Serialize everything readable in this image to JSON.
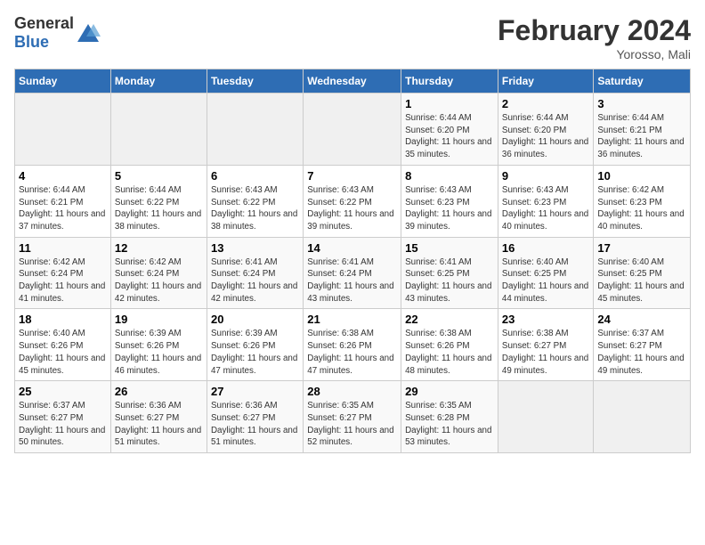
{
  "header": {
    "logo_general": "General",
    "logo_blue": "Blue",
    "month_year": "February 2024",
    "location": "Yorosso, Mali"
  },
  "days_of_week": [
    "Sunday",
    "Monday",
    "Tuesday",
    "Wednesday",
    "Thursday",
    "Friday",
    "Saturday"
  ],
  "weeks": [
    [
      {
        "day": "",
        "empty": true
      },
      {
        "day": "",
        "empty": true
      },
      {
        "day": "",
        "empty": true
      },
      {
        "day": "",
        "empty": true
      },
      {
        "day": "1",
        "sunrise": "6:44 AM",
        "sunset": "6:20 PM",
        "daylight": "11 hours and 35 minutes."
      },
      {
        "day": "2",
        "sunrise": "6:44 AM",
        "sunset": "6:20 PM",
        "daylight": "11 hours and 36 minutes."
      },
      {
        "day": "3",
        "sunrise": "6:44 AM",
        "sunset": "6:21 PM",
        "daylight": "11 hours and 36 minutes."
      }
    ],
    [
      {
        "day": "4",
        "sunrise": "6:44 AM",
        "sunset": "6:21 PM",
        "daylight": "11 hours and 37 minutes."
      },
      {
        "day": "5",
        "sunrise": "6:44 AM",
        "sunset": "6:22 PM",
        "daylight": "11 hours and 38 minutes."
      },
      {
        "day": "6",
        "sunrise": "6:43 AM",
        "sunset": "6:22 PM",
        "daylight": "11 hours and 38 minutes."
      },
      {
        "day": "7",
        "sunrise": "6:43 AM",
        "sunset": "6:22 PM",
        "daylight": "11 hours and 39 minutes."
      },
      {
        "day": "8",
        "sunrise": "6:43 AM",
        "sunset": "6:23 PM",
        "daylight": "11 hours and 39 minutes."
      },
      {
        "day": "9",
        "sunrise": "6:43 AM",
        "sunset": "6:23 PM",
        "daylight": "11 hours and 40 minutes."
      },
      {
        "day": "10",
        "sunrise": "6:42 AM",
        "sunset": "6:23 PM",
        "daylight": "11 hours and 40 minutes."
      }
    ],
    [
      {
        "day": "11",
        "sunrise": "6:42 AM",
        "sunset": "6:24 PM",
        "daylight": "11 hours and 41 minutes."
      },
      {
        "day": "12",
        "sunrise": "6:42 AM",
        "sunset": "6:24 PM",
        "daylight": "11 hours and 42 minutes."
      },
      {
        "day": "13",
        "sunrise": "6:41 AM",
        "sunset": "6:24 PM",
        "daylight": "11 hours and 42 minutes."
      },
      {
        "day": "14",
        "sunrise": "6:41 AM",
        "sunset": "6:24 PM",
        "daylight": "11 hours and 43 minutes."
      },
      {
        "day": "15",
        "sunrise": "6:41 AM",
        "sunset": "6:25 PM",
        "daylight": "11 hours and 43 minutes."
      },
      {
        "day": "16",
        "sunrise": "6:40 AM",
        "sunset": "6:25 PM",
        "daylight": "11 hours and 44 minutes."
      },
      {
        "day": "17",
        "sunrise": "6:40 AM",
        "sunset": "6:25 PM",
        "daylight": "11 hours and 45 minutes."
      }
    ],
    [
      {
        "day": "18",
        "sunrise": "6:40 AM",
        "sunset": "6:26 PM",
        "daylight": "11 hours and 45 minutes."
      },
      {
        "day": "19",
        "sunrise": "6:39 AM",
        "sunset": "6:26 PM",
        "daylight": "11 hours and 46 minutes."
      },
      {
        "day": "20",
        "sunrise": "6:39 AM",
        "sunset": "6:26 PM",
        "daylight": "11 hours and 47 minutes."
      },
      {
        "day": "21",
        "sunrise": "6:38 AM",
        "sunset": "6:26 PM",
        "daylight": "11 hours and 47 minutes."
      },
      {
        "day": "22",
        "sunrise": "6:38 AM",
        "sunset": "6:26 PM",
        "daylight": "11 hours and 48 minutes."
      },
      {
        "day": "23",
        "sunrise": "6:38 AM",
        "sunset": "6:27 PM",
        "daylight": "11 hours and 49 minutes."
      },
      {
        "day": "24",
        "sunrise": "6:37 AM",
        "sunset": "6:27 PM",
        "daylight": "11 hours and 49 minutes."
      }
    ],
    [
      {
        "day": "25",
        "sunrise": "6:37 AM",
        "sunset": "6:27 PM",
        "daylight": "11 hours and 50 minutes."
      },
      {
        "day": "26",
        "sunrise": "6:36 AM",
        "sunset": "6:27 PM",
        "daylight": "11 hours and 51 minutes."
      },
      {
        "day": "27",
        "sunrise": "6:36 AM",
        "sunset": "6:27 PM",
        "daylight": "11 hours and 51 minutes."
      },
      {
        "day": "28",
        "sunrise": "6:35 AM",
        "sunset": "6:27 PM",
        "daylight": "11 hours and 52 minutes."
      },
      {
        "day": "29",
        "sunrise": "6:35 AM",
        "sunset": "6:28 PM",
        "daylight": "11 hours and 53 minutes."
      },
      {
        "day": "",
        "empty": true
      },
      {
        "day": "",
        "empty": true
      }
    ]
  ],
  "labels": {
    "sunrise": "Sunrise:",
    "sunset": "Sunset:",
    "daylight": "Daylight:"
  }
}
